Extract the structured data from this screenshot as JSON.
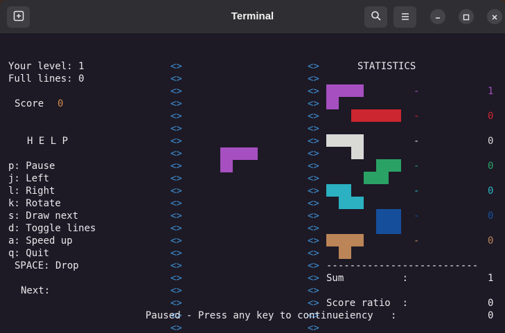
{
  "window": {
    "title": "Terminal"
  },
  "left": {
    "level_label": "Your level: 1",
    "lines_label": "Full lines: 0",
    "score_label": "Score",
    "score_value": "0",
    "help_title": "H E L P",
    "help": [
      "p: Pause",
      "j: Left",
      "l: Right",
      "k: Rotate",
      "s: Draw next",
      "d: Toggle lines",
      "a: Speed up",
      "q: Quit"
    ],
    "space_drop": "SPACE: Drop",
    "next_label": "Next:"
  },
  "board": {
    "wall_glyph": "<>"
  },
  "stats": {
    "title": "STATISTICS",
    "dash": "-",
    "rows": [
      {
        "piece": "purple-J",
        "count": "1",
        "color": "#a64fc0"
      },
      {
        "piece": "red-I",
        "count": "0",
        "color": "#cc2630"
      },
      {
        "piece": "white-J",
        "count": "0",
        "color": "#d9d9d6"
      },
      {
        "piece": "green-S",
        "count": "0",
        "color": "#2aa266"
      },
      {
        "piece": "cyan-Z",
        "count": "0",
        "color": "#2bb1c1"
      },
      {
        "piece": "blue-O",
        "count": "0",
        "color": "#154f9c"
      },
      {
        "piece": "brown-T",
        "count": "0",
        "color": "#bb8557"
      }
    ],
    "separator": "--------------------------",
    "sum_label": "Sum          :",
    "sum_value": "1",
    "ratio_label": "Score ratio  :",
    "ratio_value": "0"
  },
  "status": {
    "paused": "Paused - Press any key to continueiency   :",
    "paused_value": "0"
  },
  "active_piece": {
    "color": "#a64fc0"
  },
  "icons": [
    "new-tab-icon",
    "search-icon",
    "hamburger-menu-icon",
    "minimize-icon",
    "maximize-icon",
    "close-icon"
  ]
}
